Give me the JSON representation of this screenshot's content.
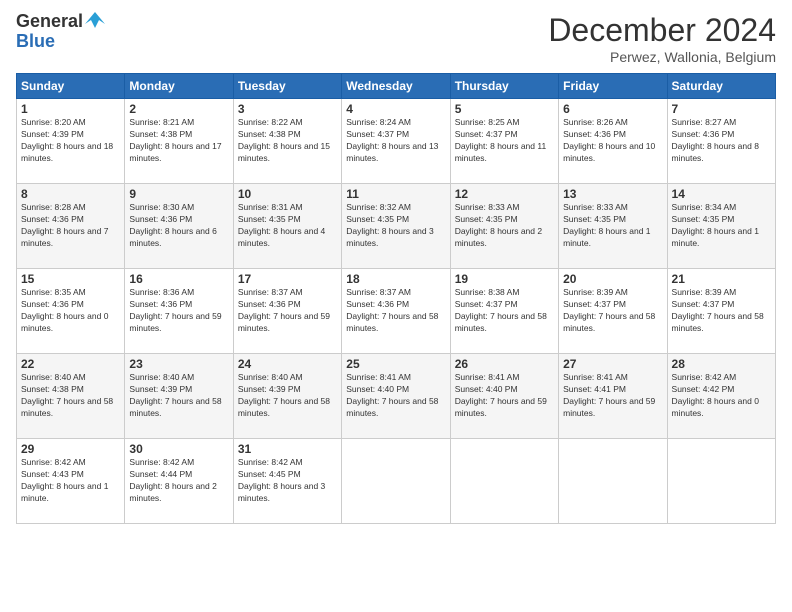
{
  "header": {
    "logo_general": "General",
    "logo_blue": "Blue",
    "month_title": "December 2024",
    "location": "Perwez, Wallonia, Belgium"
  },
  "calendar": {
    "columns": [
      "Sunday",
      "Monday",
      "Tuesday",
      "Wednesday",
      "Thursday",
      "Friday",
      "Saturday"
    ],
    "weeks": [
      [
        null,
        {
          "day": "2",
          "sunrise": "Sunrise: 8:21 AM",
          "sunset": "Sunset: 4:38 PM",
          "daylight": "Daylight: 8 hours and 17 minutes."
        },
        {
          "day": "3",
          "sunrise": "Sunrise: 8:22 AM",
          "sunset": "Sunset: 4:38 PM",
          "daylight": "Daylight: 8 hours and 15 minutes."
        },
        {
          "day": "4",
          "sunrise": "Sunrise: 8:24 AM",
          "sunset": "Sunset: 4:37 PM",
          "daylight": "Daylight: 8 hours and 13 minutes."
        },
        {
          "day": "5",
          "sunrise": "Sunrise: 8:25 AM",
          "sunset": "Sunset: 4:37 PM",
          "daylight": "Daylight: 8 hours and 11 minutes."
        },
        {
          "day": "6",
          "sunrise": "Sunrise: 8:26 AM",
          "sunset": "Sunset: 4:36 PM",
          "daylight": "Daylight: 8 hours and 10 minutes."
        },
        {
          "day": "7",
          "sunrise": "Sunrise: 8:27 AM",
          "sunset": "Sunset: 4:36 PM",
          "daylight": "Daylight: 8 hours and 8 minutes."
        }
      ],
      [
        {
          "day": "1",
          "sunrise": "Sunrise: 8:20 AM",
          "sunset": "Sunset: 4:39 PM",
          "daylight": "Daylight: 8 hours and 18 minutes."
        },
        {
          "day": "9",
          "sunrise": "Sunrise: 8:30 AM",
          "sunset": "Sunset: 4:36 PM",
          "daylight": "Daylight: 8 hours and 6 minutes."
        },
        {
          "day": "10",
          "sunrise": "Sunrise: 8:31 AM",
          "sunset": "Sunset: 4:35 PM",
          "daylight": "Daylight: 8 hours and 4 minutes."
        },
        {
          "day": "11",
          "sunrise": "Sunrise: 8:32 AM",
          "sunset": "Sunset: 4:35 PM",
          "daylight": "Daylight: 8 hours and 3 minutes."
        },
        {
          "day": "12",
          "sunrise": "Sunrise: 8:33 AM",
          "sunset": "Sunset: 4:35 PM",
          "daylight": "Daylight: 8 hours and 2 minutes."
        },
        {
          "day": "13",
          "sunrise": "Sunrise: 8:33 AM",
          "sunset": "Sunset: 4:35 PM",
          "daylight": "Daylight: 8 hours and 1 minute."
        },
        {
          "day": "14",
          "sunrise": "Sunrise: 8:34 AM",
          "sunset": "Sunset: 4:35 PM",
          "daylight": "Daylight: 8 hours and 1 minute."
        }
      ],
      [
        {
          "day": "8",
          "sunrise": "Sunrise: 8:28 AM",
          "sunset": "Sunset: 4:36 PM",
          "daylight": "Daylight: 8 hours and 7 minutes."
        },
        {
          "day": "16",
          "sunrise": "Sunrise: 8:36 AM",
          "sunset": "Sunset: 4:36 PM",
          "daylight": "Daylight: 7 hours and 59 minutes."
        },
        {
          "day": "17",
          "sunrise": "Sunrise: 8:37 AM",
          "sunset": "Sunset: 4:36 PM",
          "daylight": "Daylight: 7 hours and 59 minutes."
        },
        {
          "day": "18",
          "sunrise": "Sunrise: 8:37 AM",
          "sunset": "Sunset: 4:36 PM",
          "daylight": "Daylight: 7 hours and 58 minutes."
        },
        {
          "day": "19",
          "sunrise": "Sunrise: 8:38 AM",
          "sunset": "Sunset: 4:37 PM",
          "daylight": "Daylight: 7 hours and 58 minutes."
        },
        {
          "day": "20",
          "sunrise": "Sunrise: 8:39 AM",
          "sunset": "Sunset: 4:37 PM",
          "daylight": "Daylight: 7 hours and 58 minutes."
        },
        {
          "day": "21",
          "sunrise": "Sunrise: 8:39 AM",
          "sunset": "Sunset: 4:37 PM",
          "daylight": "Daylight: 7 hours and 58 minutes."
        }
      ],
      [
        {
          "day": "15",
          "sunrise": "Sunrise: 8:35 AM",
          "sunset": "Sunset: 4:36 PM",
          "daylight": "Daylight: 8 hours and 0 minutes."
        },
        {
          "day": "23",
          "sunrise": "Sunrise: 8:40 AM",
          "sunset": "Sunset: 4:39 PM",
          "daylight": "Daylight: 7 hours and 58 minutes."
        },
        {
          "day": "24",
          "sunrise": "Sunrise: 8:40 AM",
          "sunset": "Sunset: 4:39 PM",
          "daylight": "Daylight: 7 hours and 58 minutes."
        },
        {
          "day": "25",
          "sunrise": "Sunrise: 8:41 AM",
          "sunset": "Sunset: 4:40 PM",
          "daylight": "Daylight: 7 hours and 58 minutes."
        },
        {
          "day": "26",
          "sunrise": "Sunrise: 8:41 AM",
          "sunset": "Sunset: 4:40 PM",
          "daylight": "Daylight: 7 hours and 59 minutes."
        },
        {
          "day": "27",
          "sunrise": "Sunrise: 8:41 AM",
          "sunset": "Sunset: 4:41 PM",
          "daylight": "Daylight: 7 hours and 59 minutes."
        },
        {
          "day": "28",
          "sunrise": "Sunrise: 8:42 AM",
          "sunset": "Sunset: 4:42 PM",
          "daylight": "Daylight: 8 hours and 0 minutes."
        }
      ],
      [
        {
          "day": "22",
          "sunrise": "Sunrise: 8:40 AM",
          "sunset": "Sunset: 4:38 PM",
          "daylight": "Daylight: 7 hours and 58 minutes."
        },
        {
          "day": "30",
          "sunrise": "Sunrise: 8:42 AM",
          "sunset": "Sunset: 4:44 PM",
          "daylight": "Daylight: 8 hours and 2 minutes."
        },
        {
          "day": "31",
          "sunrise": "Sunrise: 8:42 AM",
          "sunset": "Sunset: 4:45 PM",
          "daylight": "Daylight: 8 hours and 3 minutes."
        },
        null,
        null,
        null,
        null
      ],
      [
        {
          "day": "29",
          "sunrise": "Sunrise: 8:42 AM",
          "sunset": "Sunset: 4:43 PM",
          "daylight": "Daylight: 8 hours and 1 minute."
        },
        null,
        null,
        null,
        null,
        null,
        null
      ]
    ]
  }
}
